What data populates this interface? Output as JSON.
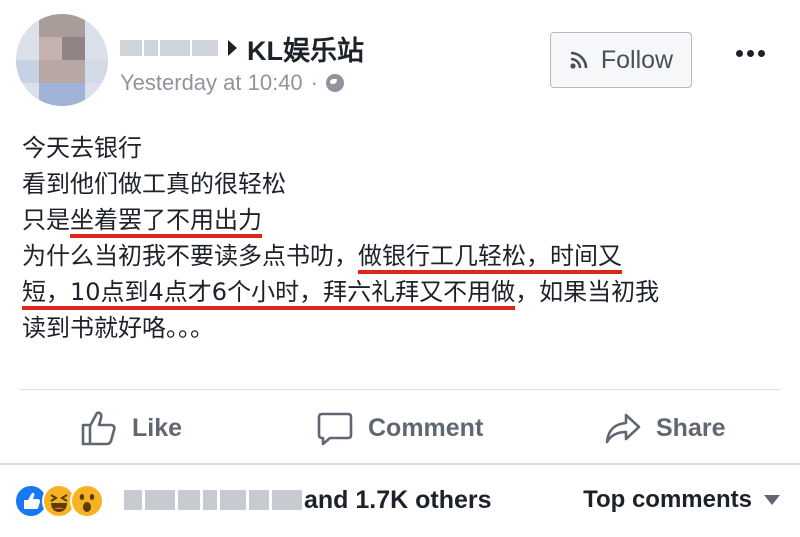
{
  "header": {
    "page_name": "KL娱乐站",
    "timestamp": "Yesterday at 10:40",
    "separator": "·",
    "privacy_icon": "globe-icon",
    "follow_icon": "rss-icon",
    "follow_label": "Follow",
    "more_icon": "more-dots-icon"
  },
  "post": {
    "line1": "今天去银行",
    "line2": "看到他们做工真的很轻松",
    "line3_a": "只是",
    "line3_b": "坐着罢了不用出力",
    "line4_a": "为什么当初我不要读多点书叻，",
    "line4_b": "做银行工几轻松，时间又",
    "line5_a": "短，10点到4点才6个小时，拜六礼拜又不用做",
    "line5_b": "，如果当初我",
    "line6": "读到书就好咯。。。",
    "underline_color": "#e0261a"
  },
  "actions": {
    "like_label": "Like",
    "like_icon": "thumbs-up-icon",
    "comment_label": "Comment",
    "comment_icon": "comment-bubble-icon",
    "share_label": "Share",
    "share_icon": "share-arrow-icon"
  },
  "reactions": {
    "icons": [
      "like-reaction-icon",
      "haha-reaction-icon",
      "wow-reaction-icon"
    ],
    "others_text": "and 1.7K others",
    "top_comments_label": "Top comments"
  },
  "colors": {
    "text": "#1d2129",
    "muted": "#90949c",
    "action": "#606770",
    "like_blue": "#1877f2",
    "reaction_yellow": "#f7b125"
  }
}
